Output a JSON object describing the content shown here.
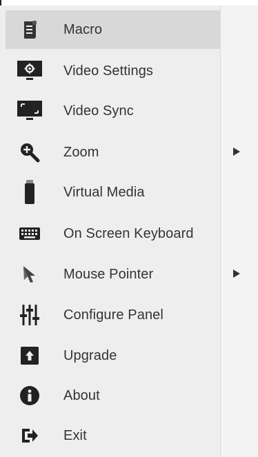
{
  "menu": {
    "items": [
      {
        "label": "Macro",
        "icon": "scroll-icon"
      },
      {
        "label": "Video Settings",
        "icon": "monitor-gear-icon"
      },
      {
        "label": "Video Sync",
        "icon": "monitor-sync-icon"
      },
      {
        "label": "Zoom",
        "icon": "zoom-in-icon",
        "submenu": true
      },
      {
        "label": "Virtual Media",
        "icon": "usb-drive-icon"
      },
      {
        "label": "On Screen Keyboard",
        "icon": "keyboard-icon"
      },
      {
        "label": "Mouse Pointer",
        "icon": "mouse-pointer-icon",
        "submenu": true
      },
      {
        "label": "Configure Panel",
        "icon": "sliders-icon"
      },
      {
        "label": "Upgrade",
        "icon": "upgrade-icon"
      },
      {
        "label": "About",
        "icon": "info-icon"
      },
      {
        "label": "Exit",
        "icon": "exit-icon"
      }
    ],
    "highlighted_index": 0
  },
  "colors": {
    "background": "#eeeeee",
    "highlight": "#d8d8d8",
    "text": "#333333",
    "icon": "#222222"
  }
}
